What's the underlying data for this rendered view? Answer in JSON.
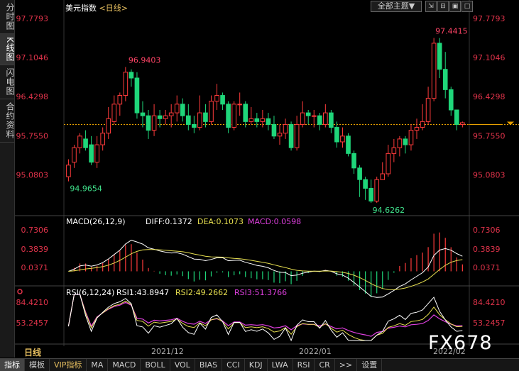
{
  "sidebar": {
    "tabs": [
      {
        "label": "分时图",
        "active": false
      },
      {
        "label": "K线图",
        "active": true
      },
      {
        "label": "闪电图",
        "active": false
      },
      {
        "label": "合约资料",
        "active": false
      }
    ]
  },
  "header": {
    "title": "美元指数",
    "period_tag": "<日线>",
    "theme_button": "全部主题▼"
  },
  "window_controls": [
    "⇲",
    "⊟",
    "▣",
    "□"
  ],
  "period_label": "日线",
  "watermark": "FX678",
  "x_labels": [
    "2021/12",
    "2022/01",
    "2022/02"
  ],
  "bottom_tabs": [
    {
      "label": "指标",
      "active": true
    },
    {
      "label": "模板"
    },
    {
      "label": "VIP指标",
      "vip": true
    },
    {
      "label": "MA"
    },
    {
      "label": "MACD"
    },
    {
      "label": "BOLL"
    },
    {
      "label": "VOL"
    },
    {
      "label": "BIAS"
    },
    {
      "label": "CCI"
    },
    {
      "label": "KDJ"
    },
    {
      "label": "LWA"
    },
    {
      "label": "RSI"
    },
    {
      "label": "CR"
    },
    {
      "label": ">>"
    },
    {
      "label": "设置"
    }
  ],
  "colors": {
    "up": "#ff3b3b",
    "down": "#1fd67a",
    "axis_text": "#e0334a",
    "grid": "#333333",
    "macd_diff": "#ffffff",
    "macd_dea": "#e8e050",
    "rsi3": "#e040e0"
  },
  "chart_data": {
    "type": "candlestick",
    "ylim": [
      94.55,
      97.85
    ],
    "y_ticks": [
      "97.7793",
      "97.1046",
      "96.4298",
      "95.7550",
      "95.0803"
    ],
    "current_price": 95.95,
    "annotations": {
      "high": "97.4415",
      "high_left": "96.9403",
      "low": "94.6262",
      "low_left": "94.9654"
    },
    "candles": [
      [
        95.05,
        95.25,
        94.97,
        95.35
      ],
      [
        95.3,
        95.55,
        95.2,
        95.6
      ],
      [
        95.55,
        95.75,
        95.45,
        95.8
      ],
      [
        95.7,
        95.55,
        95.5,
        95.85
      ],
      [
        95.6,
        95.3,
        95.25,
        95.75
      ],
      [
        95.3,
        95.6,
        95.2,
        95.75
      ],
      [
        95.6,
        95.8,
        95.5,
        95.9
      ],
      [
        95.8,
        96.05,
        95.7,
        96.25
      ],
      [
        96.0,
        96.3,
        95.95,
        96.45
      ],
      [
        96.3,
        96.45,
        96.1,
        96.5
      ],
      [
        96.45,
        96.85,
        96.35,
        96.94
      ],
      [
        96.85,
        96.75,
        96.6,
        96.9
      ],
      [
        96.75,
        96.15,
        96.05,
        96.85
      ],
      [
        96.15,
        96.1,
        95.9,
        96.35
      ],
      [
        96.1,
        95.85,
        95.7,
        96.2
      ],
      [
        95.85,
        96.1,
        95.75,
        96.3
      ],
      [
        96.1,
        96.05,
        95.9,
        96.2
      ],
      [
        96.05,
        96.1,
        95.95,
        96.2
      ],
      [
        96.1,
        96.15,
        95.9,
        96.3
      ],
      [
        96.15,
        96.3,
        96.0,
        96.45
      ],
      [
        96.3,
        96.1,
        96.0,
        96.4
      ],
      [
        96.1,
        95.95,
        95.85,
        96.3
      ],
      [
        95.95,
        95.9,
        95.8,
        96.1
      ],
      [
        95.9,
        96.15,
        95.85,
        96.45
      ],
      [
        96.15,
        96.0,
        95.9,
        96.3
      ],
      [
        96.0,
        96.35,
        95.95,
        96.45
      ],
      [
        96.35,
        96.45,
        96.2,
        96.65
      ],
      [
        96.45,
        96.3,
        96.2,
        96.5
      ],
      [
        96.3,
        95.9,
        95.8,
        96.35
      ],
      [
        95.9,
        96.3,
        95.85,
        96.35
      ],
      [
        96.3,
        96.3,
        96.1,
        96.5
      ],
      [
        96.3,
        96.0,
        95.9,
        96.35
      ],
      [
        96.0,
        96.05,
        95.95,
        96.25
      ],
      [
        96.05,
        96.0,
        95.9,
        96.15
      ],
      [
        96.0,
        96.05,
        95.9,
        96.2
      ],
      [
        96.05,
        95.95,
        95.85,
        96.15
      ],
      [
        95.95,
        95.75,
        95.7,
        96.1
      ],
      [
        95.75,
        95.8,
        95.6,
        95.95
      ],
      [
        95.8,
        95.95,
        95.7,
        96.05
      ],
      [
        95.95,
        95.55,
        95.5,
        96.0
      ],
      [
        95.55,
        95.95,
        95.5,
        96.1
      ],
      [
        95.95,
        96.15,
        95.9,
        96.35
      ],
      [
        96.15,
        96.1,
        95.95,
        96.2
      ],
      [
        96.1,
        96.1,
        95.9,
        96.2
      ],
      [
        96.1,
        95.95,
        95.85,
        96.15
      ],
      [
        95.95,
        96.15,
        95.9,
        96.3
      ],
      [
        96.15,
        95.9,
        95.8,
        96.2
      ],
      [
        95.9,
        95.65,
        95.55,
        96.0
      ],
      [
        95.65,
        95.75,
        95.55,
        95.9
      ],
      [
        95.75,
        95.45,
        95.4,
        95.8
      ],
      [
        95.45,
        95.2,
        95.1,
        95.5
      ],
      [
        95.2,
        95.0,
        94.7,
        95.25
      ],
      [
        95.0,
        94.85,
        94.65,
        95.05
      ],
      [
        94.85,
        94.63,
        94.6,
        95.0
      ],
      [
        94.63,
        95.0,
        94.6,
        95.05
      ],
      [
        95.0,
        95.1,
        95.0,
        95.3
      ],
      [
        95.1,
        95.45,
        95.05,
        95.6
      ],
      [
        95.45,
        95.55,
        95.3,
        95.7
      ],
      [
        95.55,
        95.7,
        95.4,
        95.75
      ],
      [
        95.7,
        95.6,
        95.45,
        95.75
      ],
      [
        95.6,
        95.85,
        95.5,
        95.95
      ],
      [
        95.85,
        95.9,
        95.7,
        96.05
      ],
      [
        95.9,
        96.0,
        95.85,
        96.3
      ],
      [
        96.0,
        96.4,
        95.95,
        96.6
      ],
      [
        96.4,
        97.35,
        96.35,
        97.44
      ],
      [
        97.35,
        96.9,
        96.75,
        97.44
      ],
      [
        96.9,
        96.55,
        96.4,
        97.2
      ],
      [
        96.55,
        96.2,
        96.1,
        96.6
      ],
      [
        96.2,
        95.95,
        95.85,
        96.2
      ],
      [
        95.95,
        95.98,
        95.9,
        96.0
      ]
    ],
    "macd": {
      "label": "MACD(26,12,9)",
      "diff": "DIFF:0.1372",
      "dea": "DEA:0.1073",
      "macd": "MACD:0.0598",
      "ylim": [
        -0.12,
        0.82
      ],
      "y_ticks": [
        "0.7306",
        "0.3839",
        "0.0371"
      ]
    },
    "rsi": {
      "label": "RSI(6,12,24)",
      "rsi1": "RSI1:43.8947",
      "rsi2": "RSI2:49.2662",
      "rsi3": "RSI3:51.3766",
      "ylim": [
        30,
        95
      ],
      "y_ticks": [
        "84.4210",
        "53.2457"
      ]
    }
  }
}
